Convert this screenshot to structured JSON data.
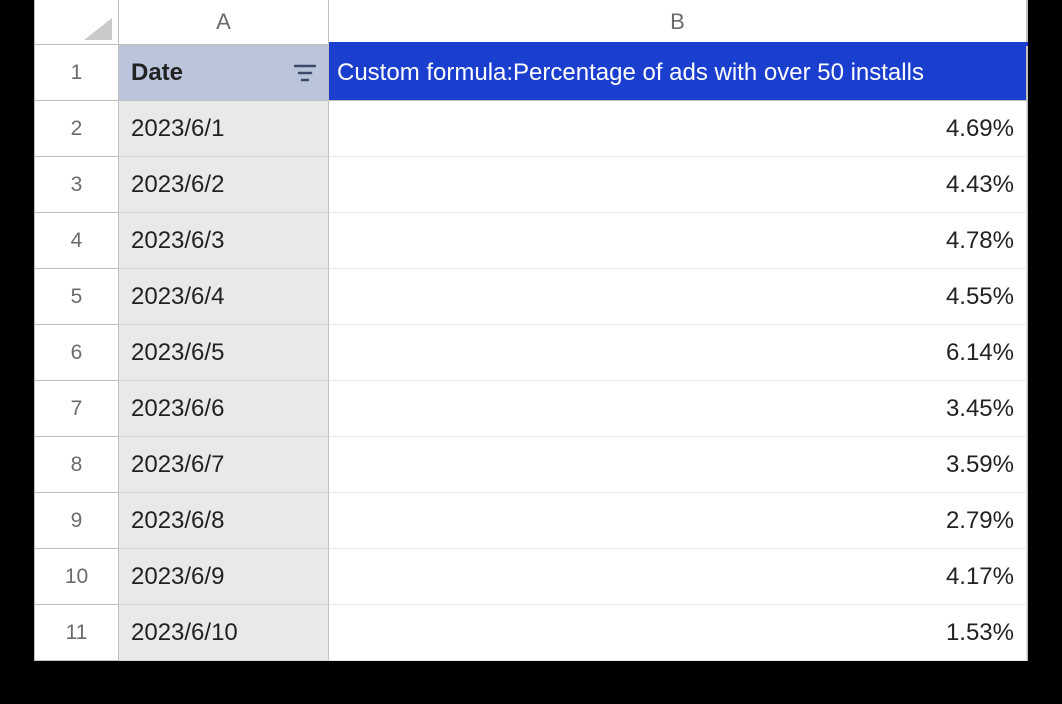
{
  "columns": {
    "a_letter": "A",
    "b_letter": "B"
  },
  "header": {
    "a_label": "Date",
    "b_label": "Custom formula:Percentage of ads with over 50 installs"
  },
  "rows": [
    {
      "num": "1"
    },
    {
      "num": "2",
      "date": "2023/6/1",
      "value": "4.69%"
    },
    {
      "num": "3",
      "date": "2023/6/2",
      "value": "4.43%"
    },
    {
      "num": "4",
      "date": "2023/6/3",
      "value": "4.78%"
    },
    {
      "num": "5",
      "date": "2023/6/4",
      "value": "4.55%"
    },
    {
      "num": "6",
      "date": "2023/6/5",
      "value": "6.14%"
    },
    {
      "num": "7",
      "date": "2023/6/6",
      "value": "3.45%"
    },
    {
      "num": "8",
      "date": "2023/6/7",
      "value": "3.59%"
    },
    {
      "num": "9",
      "date": "2023/6/8",
      "value": "2.79%"
    },
    {
      "num": "10",
      "date": "2023/6/9",
      "value": "4.17%"
    },
    {
      "num": "11",
      "date": "2023/6/10",
      "value": "1.53%"
    }
  ],
  "chart_data": {
    "type": "table",
    "title": "Custom formula:Percentage of ads with over 50 installs",
    "columns": [
      "Date",
      "Percentage of ads with over 50 installs"
    ],
    "data": [
      [
        "2023/6/1",
        4.69
      ],
      [
        "2023/6/2",
        4.43
      ],
      [
        "2023/6/3",
        4.78
      ],
      [
        "2023/6/4",
        4.55
      ],
      [
        "2023/6/5",
        6.14
      ],
      [
        "2023/6/6",
        3.45
      ],
      [
        "2023/6/7",
        3.59
      ],
      [
        "2023/6/8",
        2.79
      ],
      [
        "2023/6/9",
        4.17
      ],
      [
        "2023/6/10",
        1.53
      ]
    ]
  }
}
